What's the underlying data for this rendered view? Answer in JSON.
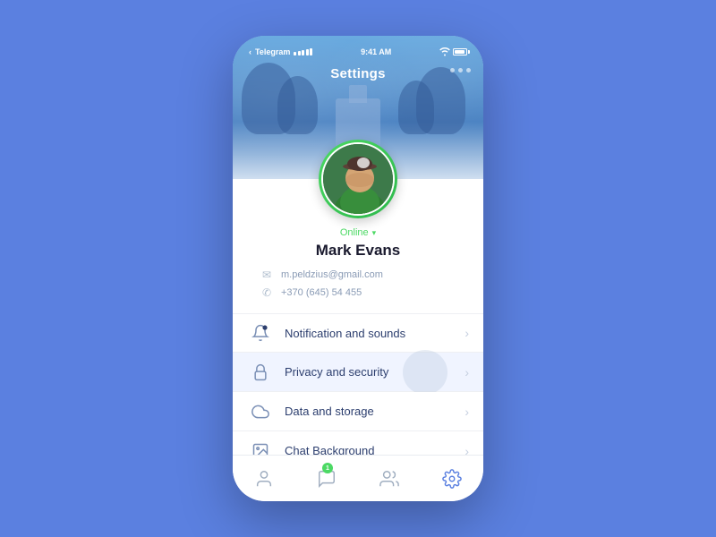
{
  "statusBar": {
    "carrier": "Telegram",
    "signal": "●●●●●",
    "wifi": "wifi",
    "time": "9:41 AM",
    "battery": "100"
  },
  "header": {
    "title": "Settings",
    "dots": [
      "dot1",
      "dot2",
      "dot3"
    ]
  },
  "user": {
    "statusLabel": "Online",
    "name": "Mark Evans",
    "email": "m.peldzius@gmail.com",
    "phone": "+370 (645) 54 455"
  },
  "menu": {
    "items": [
      {
        "id": "notifications",
        "label": "Notification and sounds",
        "icon": "bell"
      },
      {
        "id": "privacy",
        "label": "Privacy and security",
        "icon": "lock"
      },
      {
        "id": "storage",
        "label": "Data and storage",
        "icon": "cloud"
      },
      {
        "id": "background",
        "label": "Chat Background",
        "icon": "image"
      }
    ]
  },
  "tabBar": {
    "tabs": [
      {
        "id": "profile",
        "icon": "person",
        "label": "Profile",
        "active": false,
        "badge": null
      },
      {
        "id": "messages",
        "icon": "bubble",
        "label": "Messages",
        "active": false,
        "badge": "1"
      },
      {
        "id": "contacts",
        "icon": "people",
        "label": "Contacts",
        "active": false,
        "badge": null
      },
      {
        "id": "settings",
        "icon": "gear",
        "label": "Settings",
        "active": true,
        "badge": null
      }
    ]
  }
}
